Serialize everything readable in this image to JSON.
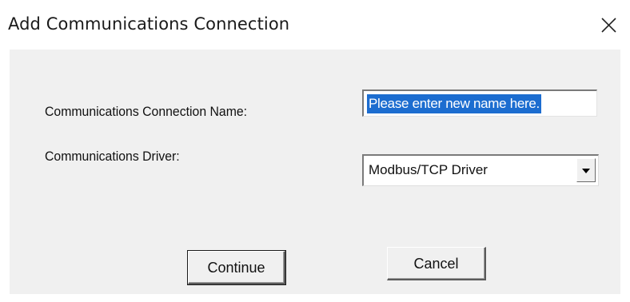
{
  "dialog": {
    "title": "Add Communications Connection",
    "close_icon": "close-icon"
  },
  "form": {
    "name_label": "Communications Connection Name:",
    "name_value": "Please enter new name here.",
    "driver_label": "Communications Driver:",
    "driver_selected": "Modbus/TCP Driver",
    "dropdown_icon": "chevron-down-icon"
  },
  "buttons": {
    "continue_label": "Continue",
    "cancel_label": "Cancel"
  },
  "colors": {
    "selection_highlight": "#1c6dd0",
    "client_background": "#f0f0f0"
  }
}
